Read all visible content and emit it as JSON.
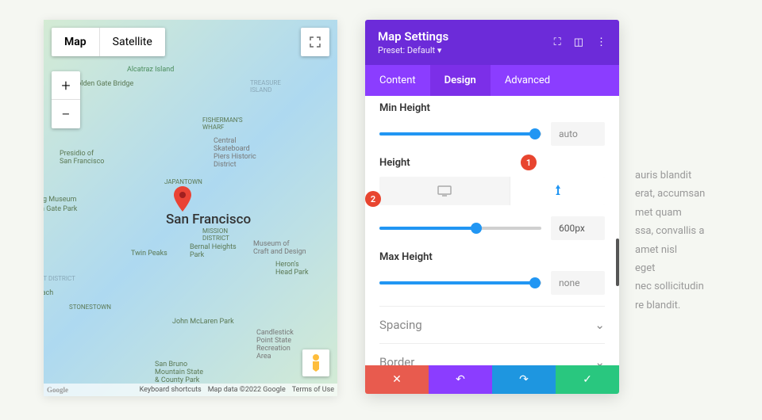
{
  "map": {
    "tabs": {
      "map": "Map",
      "satellite": "Satellite"
    },
    "city": "San Francisco",
    "labels": {
      "alcatraz": "Alcatraz Island",
      "ggb": "Golden Gate Bridge",
      "treasure": "TREASURE\nISLAND",
      "fisherman": "FISHERMAN'S\nWHARF",
      "presidio": "Presidio of\nSan Francisco",
      "district": "Central\nSkateboard\nPiers Historic\nDistrict",
      "japantown": "JAPANTOWN",
      "mission": "MISSION\nDISTRICT",
      "twin": "Twin Peaks",
      "bernal": "Bernal Heights\nPark",
      "heron": "Heron's\nHead Park",
      "museum": "ng Museum",
      "gate": "lden Gate Park",
      "craft": "Museum of\nCraft and Design",
      "stonestown": "STONESTOWN",
      "mclaren": "John McLaren Park",
      "candlestick": "Candlestick\nPoint State\nRecreation\nArea",
      "sanbruno": "San Bruno\nMountain State\n& County Park",
      "sunset": "SET DISTRICT",
      "ocean": "n Beach"
    },
    "footer": {
      "google": "Google",
      "shortcuts": "Keyboard shortcuts",
      "mapdata": "Map data ©2022 Google",
      "terms": "Terms of Use"
    }
  },
  "panel": {
    "title": "Map Settings",
    "preset": "Preset: Default",
    "tabs": {
      "content": "Content",
      "design": "Design",
      "advanced": "Advanced"
    },
    "fields": {
      "minheight": {
        "label": "Min Height",
        "value": "auto"
      },
      "height": {
        "label": "Height",
        "value": "600px"
      },
      "maxheight": {
        "label": "Max Height",
        "value": "none"
      }
    },
    "sections": {
      "spacing": "Spacing",
      "border": "Border"
    }
  },
  "callouts": {
    "one": "1",
    "two": "2"
  },
  "bgtext": "auris blandit\nerat, accumsan\nmet quam\nssa, convallis a\n amet nisl\neget\nnec sollicitudin\nre blandit."
}
